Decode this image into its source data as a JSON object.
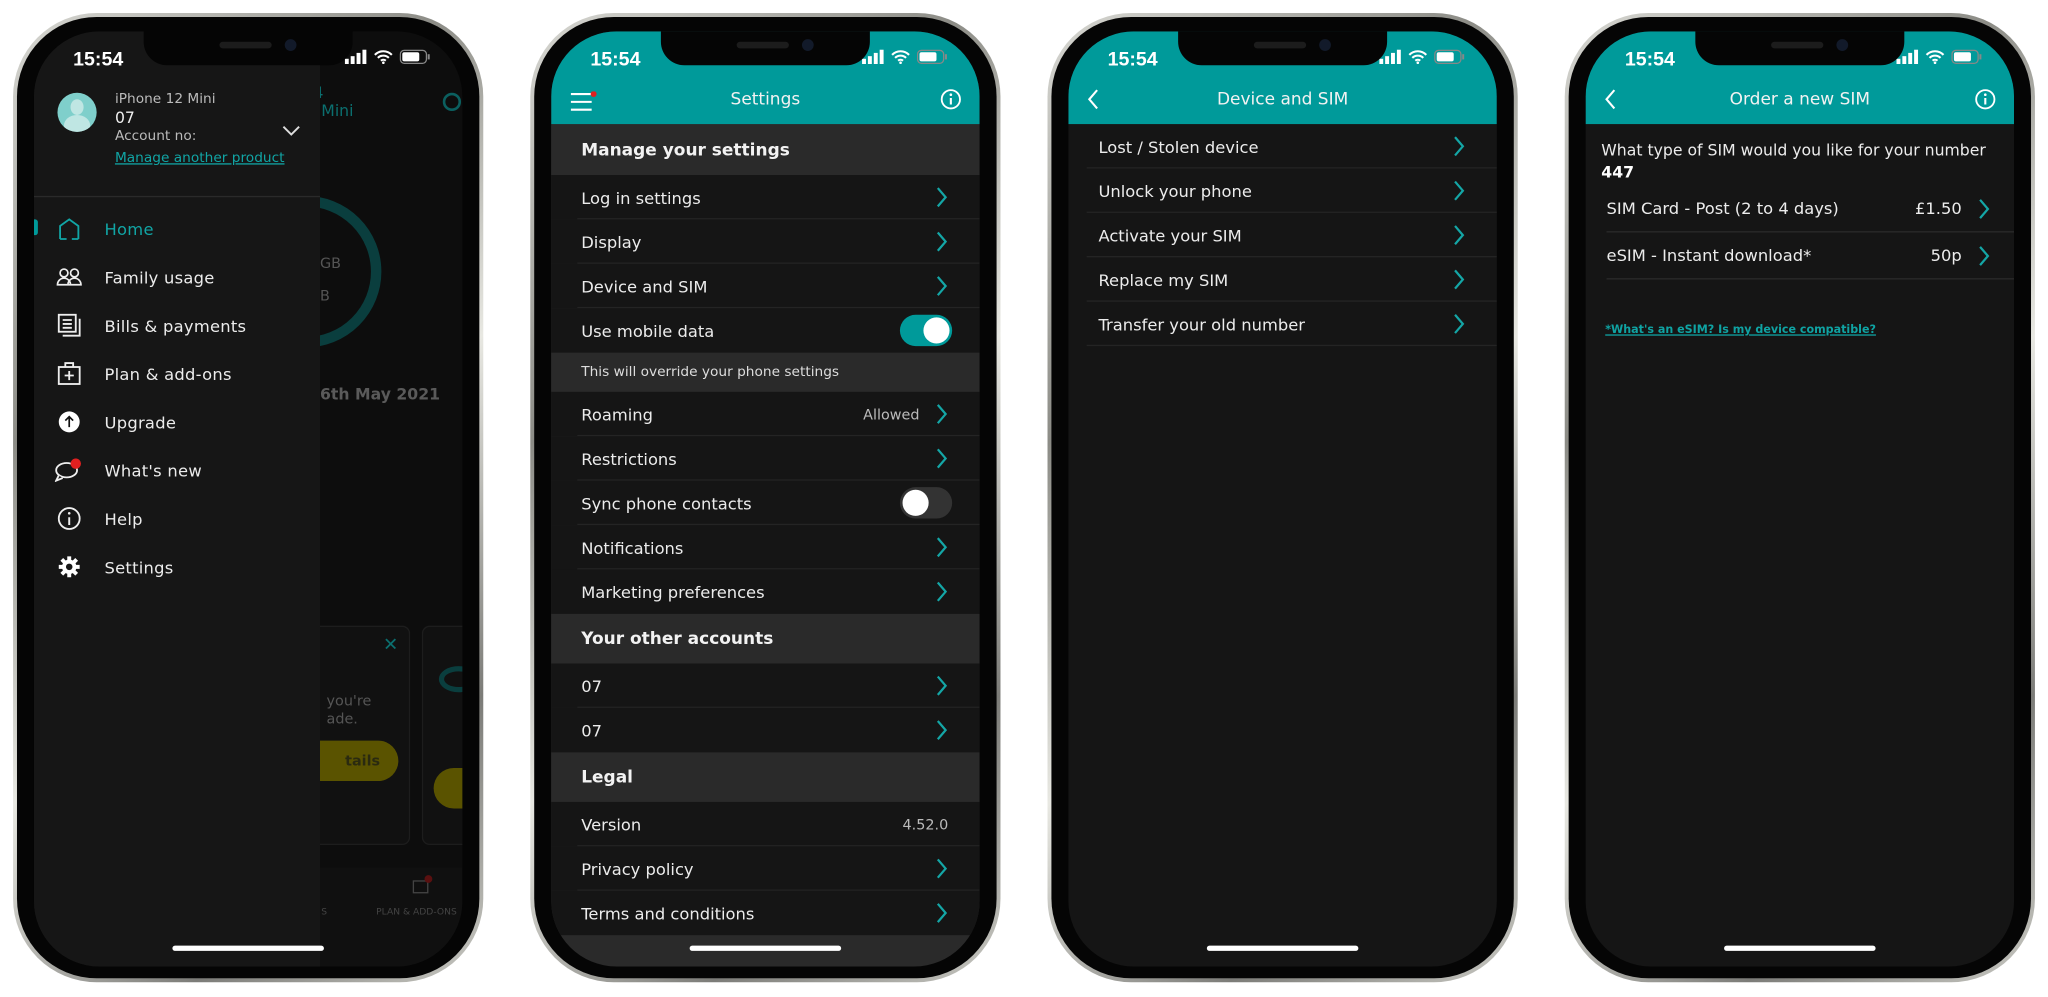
{
  "status_bar": {
    "time": "15:54"
  },
  "colors": {
    "accent": "#009a9a",
    "background": "#151515",
    "section": "#2a2a2a",
    "badge": "#e02020",
    "cta_yellow": "#c9b800"
  },
  "screen1_menu": {
    "account": {
      "device_name": "iPhone 12 Mini",
      "number": "07",
      "account_label": "Account no:",
      "manage_link": "Manage another product"
    },
    "items": [
      {
        "label": "Home",
        "icon": "home-icon",
        "active": true
      },
      {
        "label": "Family usage",
        "icon": "family-icon"
      },
      {
        "label": "Bills & payments",
        "icon": "bills-icon"
      },
      {
        "label": "Plan & add-ons",
        "icon": "plan-icon"
      },
      {
        "label": "Upgrade",
        "icon": "upgrade-icon"
      },
      {
        "label": "What's new",
        "icon": "chat-icon",
        "badge": true
      },
      {
        "label": "Help",
        "icon": "info-icon"
      },
      {
        "label": "Settings",
        "icon": "gear-icon"
      }
    ],
    "background": {
      "header_fragment_1": "4",
      "header_fragment_2": "Mini",
      "ring_text_1": "GB",
      "ring_text_2": "B",
      "date_fragment": "6th May 2021",
      "card_text_1": "you're",
      "card_text_2": "ade.",
      "card_button": "tails",
      "nav_left_fragment": "S",
      "nav_plan": "PLAN & ADD-ONS"
    }
  },
  "screen2_settings": {
    "title": "Settings",
    "items": [
      {
        "type": "section",
        "label": "Manage your settings"
      },
      {
        "type": "row",
        "label": "Log in settings",
        "chevron": true
      },
      {
        "type": "row",
        "label": "Display",
        "chevron": true
      },
      {
        "type": "row",
        "label": "Device and SIM",
        "chevron": true
      },
      {
        "type": "row",
        "label": "Use mobile data",
        "toggle": true,
        "on": true
      },
      {
        "type": "note",
        "label": "This will override your phone settings"
      },
      {
        "type": "row",
        "label": "Roaming",
        "value": "Allowed",
        "chevron": true
      },
      {
        "type": "row",
        "label": "Restrictions",
        "chevron": true
      },
      {
        "type": "row",
        "label": "Sync phone contacts",
        "toggle": true,
        "on": false
      },
      {
        "type": "row",
        "label": "Notifications",
        "chevron": true
      },
      {
        "type": "row",
        "label": "Marketing preferences",
        "chevron": true
      },
      {
        "type": "section",
        "label": "Your other accounts"
      },
      {
        "type": "row",
        "label": "07",
        "chevron": true
      },
      {
        "type": "row",
        "label": "07",
        "chevron": true
      },
      {
        "type": "section",
        "label": "Legal"
      },
      {
        "type": "row",
        "label": "Version",
        "value": "4.52.0"
      },
      {
        "type": "row",
        "label": "Privacy policy",
        "chevron": true
      },
      {
        "type": "row",
        "label": "Terms and conditions",
        "chevron": true
      }
    ]
  },
  "screen3_device": {
    "title": "Device and SIM",
    "items": [
      {
        "label": "Lost / Stolen device"
      },
      {
        "label": "Unlock your phone"
      },
      {
        "label": "Activate your SIM"
      },
      {
        "label": "Replace my SIM"
      },
      {
        "label": "Transfer your old number"
      }
    ]
  },
  "screen4_order": {
    "title": "Order a new SIM",
    "question": "What type of SIM would you like for your number",
    "number": "447",
    "options": [
      {
        "label": "SIM Card - Post (2 to 4 days)",
        "price": "£1.50"
      },
      {
        "label": "eSIM - Instant download*",
        "price": "50p"
      }
    ],
    "esim_link": "*What's an eSIM? Is my device compatible?"
  }
}
